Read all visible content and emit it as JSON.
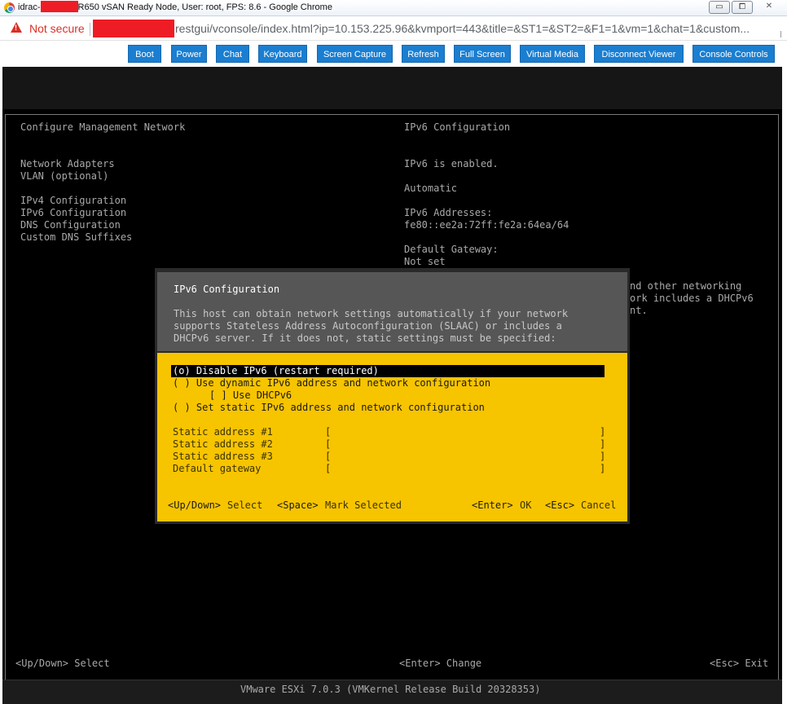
{
  "browser": {
    "title_prefix": "idrac-",
    "title_suffix": "R650 vSAN Ready Node, User: root, FPS: 8.6 - Google Chrome",
    "not_secure": "Not secure",
    "url": "restgui/vconsole/index.html?ip=10.153.225.96&kvmport=443&title=&ST1=&ST2=&F1=1&vm=1&chat=1&custom...",
    "minimize": "▭",
    "restore": "⧠",
    "close": "✕",
    "redaction_color": "#ee1c25"
  },
  "toolbar": {
    "buttons": [
      {
        "label": "Boot"
      },
      {
        "label": "Power"
      },
      {
        "label": "Chat"
      },
      {
        "label": "Keyboard"
      },
      {
        "label": "Screen Capture"
      },
      {
        "label": "Refresh"
      },
      {
        "label": "Full Screen"
      },
      {
        "label": "Virtual Media"
      },
      {
        "label": "Disconnect Viewer"
      },
      {
        "label": "Console Controls"
      }
    ],
    "button_color": "#1a7ed1"
  },
  "esxi": {
    "left_header": "Configure Management Network",
    "menu": [
      "Network Adapters",
      "VLAN (optional)",
      "IPv4 Configuration",
      "IPv6 Configuration",
      "DNS Configuration",
      "Custom DNS Suffixes"
    ],
    "right_header": "IPv6 Configuration",
    "right": {
      "enabled": "IPv6 is enabled.",
      "mode": "Automatic",
      "addresses_label": "IPv6 Addresses:",
      "address": "fe80::ee2a:72ff:fe2a:64ea/64",
      "gateway_label": "Default Gateway:",
      "gateway": "Not set",
      "cut_line1": "nd other networking",
      "cut_line2": "ork includes a DHCPv6",
      "cut_line3": "nt."
    },
    "footer_left": "<Up/Down> Select",
    "footer_center": "<Enter> Change",
    "footer_right": "<Esc> Exit",
    "bottom": "VMware ESXi 7.0.3 (VMKernel Release Build 20328353)"
  },
  "dialog": {
    "title": "IPv6 Configuration",
    "desc1": "This host can obtain network settings automatically if your network",
    "desc2": "supports Stateless Address Autoconfiguration (SLAAC) or includes a",
    "desc3": "DHCPv6 server. If it does not, static settings must be specified:",
    "opt_disable": "(o) Disable IPv6 (restart required)",
    "opt_dynamic": "( ) Use dynamic IPv6 address and network configuration",
    "opt_dhcp": "[ ] Use DHCPv6",
    "opt_static": "( ) Set static IPv6 address and network configuration",
    "fields": [
      {
        "label": "Static address #1",
        "value": ""
      },
      {
        "label": "Static address #2",
        "value": ""
      },
      {
        "label": "Static address #3",
        "value": ""
      },
      {
        "label": "Default gateway",
        "value": ""
      }
    ],
    "bracket_open": "[",
    "bracket_close": "]",
    "key_updown": "<Up/Down>",
    "act_select": "Select",
    "key_space": "<Space>",
    "act_mark": "Mark Selected",
    "key_enter": "<Enter>",
    "act_ok": "OK",
    "key_esc": "<Esc>",
    "act_cancel": "Cancel",
    "accent": "#f7c400"
  }
}
